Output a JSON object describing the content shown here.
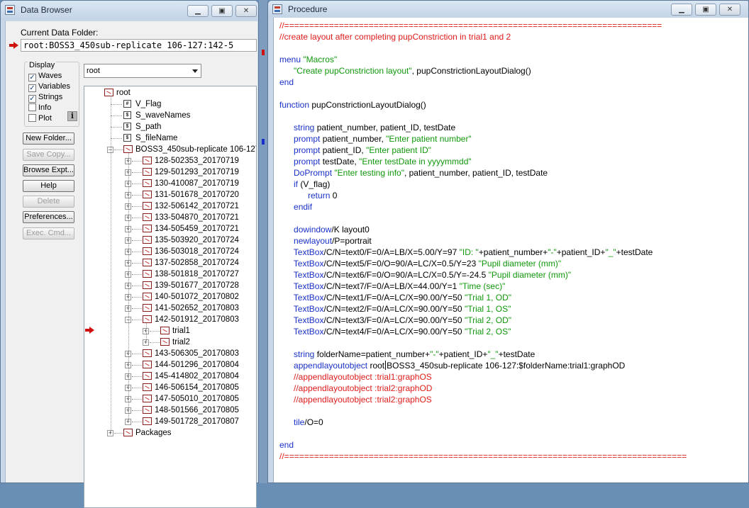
{
  "data_browser": {
    "title": "Data Browser",
    "current_data_folder_label": "Current Data Folder:",
    "current_data_folder_path": "root:BOSS3_450sub-replicate 106-127:142-5",
    "display": {
      "legend": "Display",
      "options": [
        {
          "label": "Waves",
          "checked": true
        },
        {
          "label": "Variables",
          "checked": true
        },
        {
          "label": "Strings",
          "checked": true
        },
        {
          "label": "Info",
          "checked": false
        },
        {
          "label": "Plot",
          "checked": false
        }
      ]
    },
    "folder_select_value": "root",
    "buttons": [
      {
        "label": "New Folder...",
        "enabled": true
      },
      {
        "label": "Save Copy...",
        "enabled": false
      },
      {
        "label": "Browse Expt...",
        "enabled": true
      },
      {
        "label": "Help",
        "enabled": true
      },
      {
        "label": "Delete",
        "enabled": false
      },
      {
        "label": "Preferences...",
        "enabled": true
      },
      {
        "label": "Exec. Cmd...",
        "enabled": false
      }
    ],
    "tree": {
      "root": "root",
      "root_items": [
        {
          "label": "V_Flag",
          "type": "variable"
        },
        {
          "label": "S_waveNames",
          "type": "string"
        },
        {
          "label": "S_path",
          "type": "string"
        },
        {
          "label": "S_fileName",
          "type": "string"
        }
      ],
      "boss_folder": "BOSS3_450sub-replicate 106-127",
      "subfolders": [
        "128-502353_20170719",
        "129-501293_20170719",
        "130-410087_20170719",
        "131-501678_20170720",
        "132-506142_20170721",
        "133-504870_20170721",
        "134-505459_20170721",
        "135-503920_20170724",
        "136-503018_20170724",
        "137-502858_20170724",
        "138-501818_20170727",
        "139-501677_20170728",
        "140-501072_20170802",
        "141-502652_20170803",
        "142-501912_20170803"
      ],
      "current_children": [
        "trial1",
        "trial2"
      ],
      "subfolders_after": [
        "143-506305_20170803",
        "144-501296_20170804",
        "145-414802_20170804",
        "146-506154_20170805",
        "147-505010_20170805",
        "148-501566_20170805",
        "149-501728_20170807"
      ],
      "packages": "Packages"
    }
  },
  "procedure": {
    "title": "Procedure",
    "code": [
      [
        [
          "c",
          "//============================================================================"
        ]
      ],
      [
        [
          "c",
          "//create layout after completing pupConstriction in trial1 and 2"
        ]
      ],
      [],
      [
        [
          "k",
          "menu"
        ],
        [
          "t",
          " "
        ],
        [
          "s",
          "\"Macros\""
        ]
      ],
      [
        [
          "t",
          "      "
        ],
        [
          "s",
          "\"Create pupConstriction layout\""
        ],
        [
          "t",
          ", pupConstrictionLayoutDialog()"
        ]
      ],
      [
        [
          "k",
          "end"
        ]
      ],
      [],
      [
        [
          "k",
          "function"
        ],
        [
          "t",
          " pupConstrictionLayoutDialog()"
        ]
      ],
      [],
      [
        [
          "t",
          "      "
        ],
        [
          "k",
          "string"
        ],
        [
          "t",
          " patient_number, patient_ID, testDate"
        ]
      ],
      [
        [
          "t",
          "      "
        ],
        [
          "k",
          "prompt"
        ],
        [
          "t",
          " patient_number, "
        ],
        [
          "s",
          "\"Enter patient number\""
        ]
      ],
      [
        [
          "t",
          "      "
        ],
        [
          "k",
          "prompt"
        ],
        [
          "t",
          " patient_ID, "
        ],
        [
          "s",
          "\"Enter patient ID\""
        ]
      ],
      [
        [
          "t",
          "      "
        ],
        [
          "k",
          "prompt"
        ],
        [
          "t",
          " testDate, "
        ],
        [
          "s",
          "\"Enter testDate in yyyymmdd\""
        ]
      ],
      [
        [
          "t",
          "      "
        ],
        [
          "k",
          "DoPrompt"
        ],
        [
          "t",
          " "
        ],
        [
          "s",
          "\"Enter testing info\""
        ],
        [
          "t",
          ", patient_number, patient_ID, testDate"
        ]
      ],
      [
        [
          "t",
          "      "
        ],
        [
          "k",
          "if"
        ],
        [
          "t",
          " (V_flag)"
        ]
      ],
      [
        [
          "t",
          "            "
        ],
        [
          "k",
          "return"
        ],
        [
          "t",
          " 0"
        ]
      ],
      [
        [
          "t",
          "      "
        ],
        [
          "k",
          "endif"
        ]
      ],
      [],
      [
        [
          "t",
          "      "
        ],
        [
          "k",
          "dowindow"
        ],
        [
          "t",
          "/K layout0"
        ]
      ],
      [
        [
          "t",
          "      "
        ],
        [
          "k",
          "newlayout"
        ],
        [
          "t",
          "/P=portrait"
        ]
      ],
      [
        [
          "t",
          "      "
        ],
        [
          "k",
          "TextBox"
        ],
        [
          "t",
          "/C/N=text0/F=0/A=LB/X=5.00/Y=97 "
        ],
        [
          "s",
          "\"ID: \""
        ],
        [
          "t",
          "+patient_number+"
        ],
        [
          "s",
          "\"-\""
        ],
        [
          "t",
          "+patient_ID+"
        ],
        [
          "s",
          "\"_\""
        ],
        [
          "t",
          "+testDate"
        ]
      ],
      [
        [
          "t",
          "      "
        ],
        [
          "k",
          "TextBox"
        ],
        [
          "t",
          "/C/N=text5/F=0/O=90/A=LC/X=0.5/Y=23 "
        ],
        [
          "s",
          "\"Pupil diameter (mm)\""
        ]
      ],
      [
        [
          "t",
          "      "
        ],
        [
          "k",
          "TextBox"
        ],
        [
          "t",
          "/C/N=text6/F=0/O=90/A=LC/X=0.5/Y=-24.5 "
        ],
        [
          "s",
          "\"Pupil diameter (mm)\""
        ]
      ],
      [
        [
          "t",
          "      "
        ],
        [
          "k",
          "TextBox"
        ],
        [
          "t",
          "/C/N=text7/F=0/A=LB/X=44.00/Y=1 "
        ],
        [
          "s",
          "\"Time (sec)\""
        ]
      ],
      [
        [
          "t",
          "      "
        ],
        [
          "k",
          "TextBox"
        ],
        [
          "t",
          "/C/N=text1/F=0/A=LC/X=90.00/Y=50 "
        ],
        [
          "s",
          "\"Trial 1, OD\""
        ]
      ],
      [
        [
          "t",
          "      "
        ],
        [
          "k",
          "TextBox"
        ],
        [
          "t",
          "/C/N=text2/F=0/A=LC/X=90.00/Y=50 "
        ],
        [
          "s",
          "\"Trial 1, OS\""
        ]
      ],
      [
        [
          "t",
          "      "
        ],
        [
          "k",
          "TextBox"
        ],
        [
          "t",
          "/C/N=text3/F=0/A=LC/X=90.00/Y=50 "
        ],
        [
          "s",
          "\"Trial 2, OD\""
        ]
      ],
      [
        [
          "t",
          "      "
        ],
        [
          "k",
          "TextBox"
        ],
        [
          "t",
          "/C/N=text4/F=0/A=LC/X=90.00/Y=50 "
        ],
        [
          "s",
          "\"Trial 2, OS\""
        ]
      ],
      [],
      [
        [
          "t",
          "      "
        ],
        [
          "k",
          "string"
        ],
        [
          "t",
          " folderName=patient_number+"
        ],
        [
          "s",
          "\"-\""
        ],
        [
          "t",
          "+patient_ID+"
        ],
        [
          "s",
          "\"_\""
        ],
        [
          "t",
          "+testDate"
        ]
      ],
      [
        [
          "t",
          "      "
        ],
        [
          "k",
          "appendlayoutobject"
        ],
        [
          "t",
          " root"
        ],
        [
          "cur",
          ""
        ],
        [
          "t",
          "BOSS3_450sub-replicate 106-127:$folderName:trial1:graphOD"
        ]
      ],
      [
        [
          "t",
          "      "
        ],
        [
          "c",
          "//appendlayoutobject :trial1:graphOS"
        ]
      ],
      [
        [
          "t",
          "      "
        ],
        [
          "c",
          "//appendlayoutobject :trial2:graphOD"
        ]
      ],
      [
        [
          "t",
          "      "
        ],
        [
          "c",
          "//appendlayoutobject :trial2:graphOS"
        ]
      ],
      [],
      [
        [
          "t",
          "      "
        ],
        [
          "k",
          "tile"
        ],
        [
          "t",
          "/O=0"
        ]
      ],
      [],
      [
        [
          "k",
          "end"
        ]
      ],
      [
        [
          "c",
          "//================================================================================="
        ]
      ]
    ]
  }
}
